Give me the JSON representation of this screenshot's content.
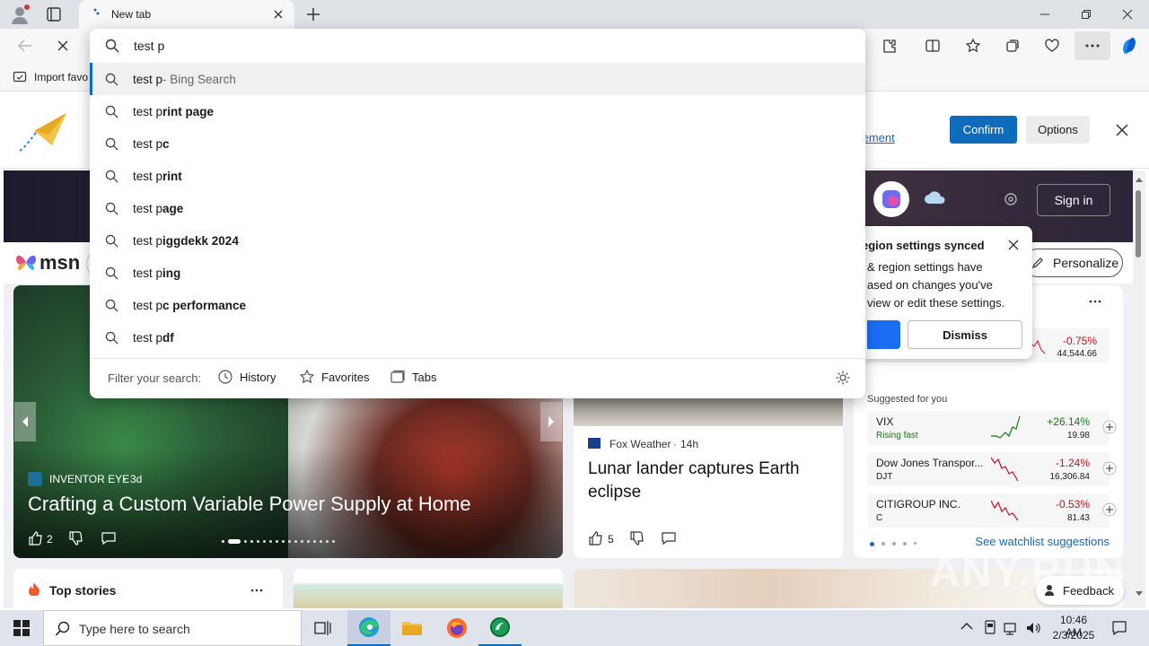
{
  "browser": {
    "tab_title": "New tab",
    "omnibox_value": "test p",
    "favorites_bar_item": "Import favo",
    "accent": "#0f6cbd"
  },
  "suggestions": [
    {
      "pre": "test p",
      "bold": "",
      "suffix": " - Bing Search"
    },
    {
      "pre": "test p",
      "bold": "rint page",
      "suffix": ""
    },
    {
      "pre": "test p",
      "bold": "c",
      "suffix": ""
    },
    {
      "pre": "test p",
      "bold": "rint",
      "suffix": ""
    },
    {
      "pre": "test p",
      "bold": "age",
      "suffix": ""
    },
    {
      "pre": "test p",
      "bold": "iggdekk 2024",
      "suffix": ""
    },
    {
      "pre": "test p",
      "bold": "ing",
      "suffix": ""
    },
    {
      "pre": "test p",
      "bold": "c performance",
      "suffix": ""
    },
    {
      "pre": "test p",
      "bold": "df",
      "suffix": ""
    }
  ],
  "filter": {
    "label": "Filter your search:",
    "history": "History",
    "favorites": "Favorites",
    "tabs": "Tabs"
  },
  "banner": {
    "link_fragment": "tement",
    "confirm": "Confirm",
    "options": "Options"
  },
  "msn": {
    "logo": "msn",
    "sign_in": "Sign in",
    "personalize": "Personalize",
    "popup_title": "egion settings synced",
    "popup_body": "& region settings have\nased on changes you've\nview or edit these settings.",
    "dismiss": "Dismiss",
    "top_stories": "Top stories",
    "feedback": "Feedback"
  },
  "main_story": {
    "source": "INVENTOR EYE",
    "age": "3d",
    "title": "Crafting a Custom Variable Power Supply at Home",
    "likes": "2"
  },
  "side_story": {
    "source": "Fox Weather",
    "age": "14h",
    "title": "Lunar lander captures Earth eclipse",
    "likes": "5"
  },
  "watchlist": {
    "top_change": "-0.75%",
    "top_value": "44,544.66",
    "suggested_label": "Suggested for you",
    "stocks": [
      {
        "name": "VIX",
        "sub": "Rising fast",
        "change": "+26.14%",
        "value": "19.98",
        "dir": "up"
      },
      {
        "name": "Dow Jones Transpor...",
        "sub": "DJT",
        "change": "-1.24%",
        "value": "16,306.84",
        "dir": "down"
      },
      {
        "name": "CITIGROUP INC.",
        "sub": "C",
        "change": "-0.53%",
        "value": "81.43",
        "dir": "down"
      }
    ],
    "see_more": "See watchlist suggestions"
  },
  "taskbar": {
    "search_placeholder": "Type here to search",
    "time": "10:46 AM",
    "date": "2/3/2025"
  },
  "watermark": "ANY.RUN"
}
